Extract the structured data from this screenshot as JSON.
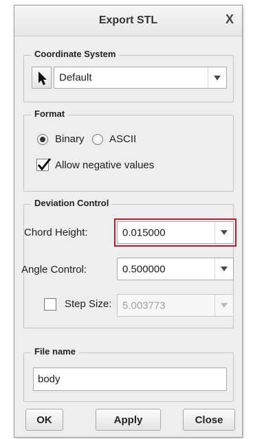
{
  "dialog": {
    "title": "Export STL",
    "close_glyph": "X"
  },
  "coordinate_system": {
    "legend": "Coordinate System",
    "selector_icon": "arrow-pointer-icon",
    "value": "Default"
  },
  "format": {
    "legend": "Format",
    "binary_label": "Binary",
    "ascii_label": "ASCII",
    "selected": "Binary",
    "allow_negative_label": "Allow negative values",
    "allow_negative_checked": true
  },
  "deviation_control": {
    "legend": "Deviation Control",
    "chord_height_label": "Chord Height:",
    "chord_height_value": "0.015000",
    "angle_control_label": "Angle Control:",
    "angle_control_value": "0.500000",
    "step_size_label": "Step Size:",
    "step_size_value": "5.003773",
    "step_size_checked": false,
    "highlight_color": "#b01e2e"
  },
  "file_name": {
    "legend": "File name",
    "value": "body"
  },
  "buttons": {
    "ok": "OK",
    "apply": "Apply",
    "close": "Close"
  }
}
